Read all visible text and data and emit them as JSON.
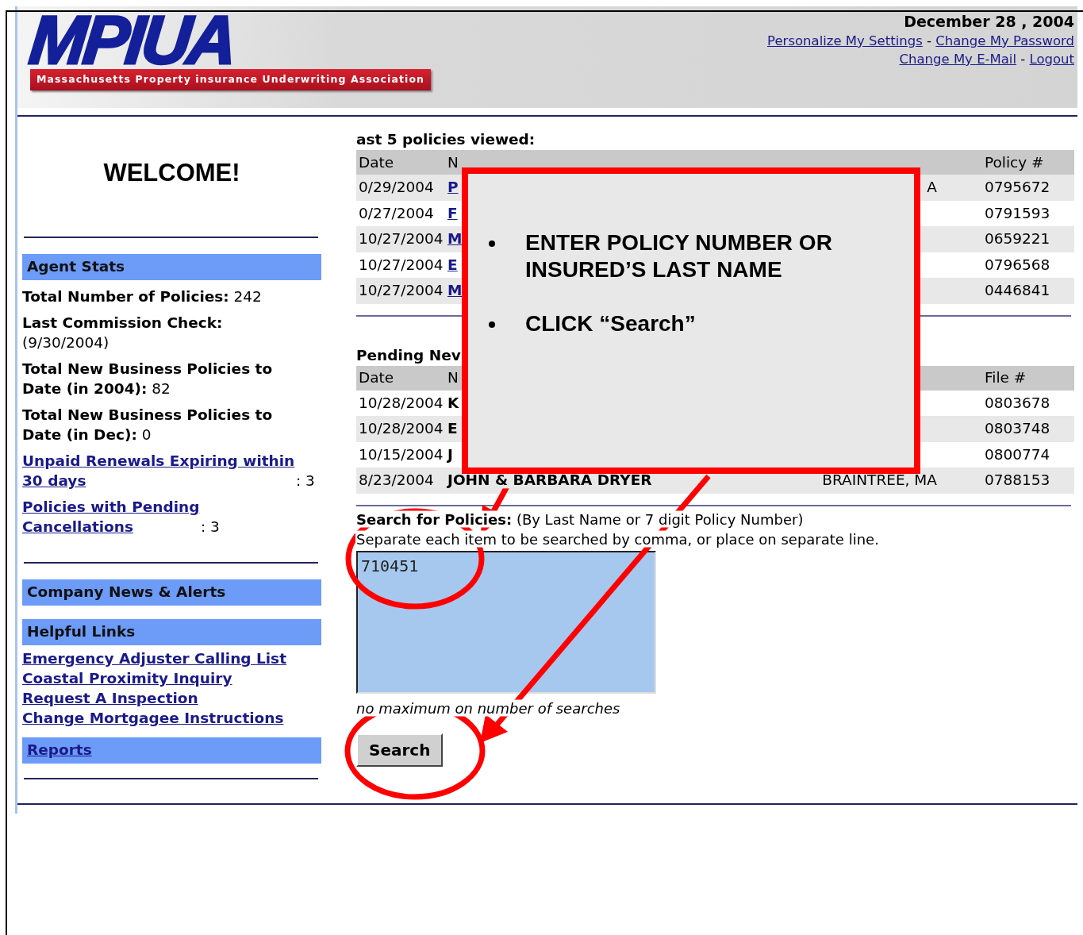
{
  "header": {
    "logo": "MPIUA",
    "logo_subtitle": "Massachusetts Property insurance Underwriting Association",
    "date": "December 28 , 2004",
    "link_rows": [
      [
        "Personalize My Settings",
        "Change My Password"
      ],
      [
        "Change My E-Mail",
        "Logout"
      ]
    ],
    "link_separator": "-"
  },
  "welcome": "WELCOME!",
  "agent_stats": {
    "title": "Agent Stats",
    "items": [
      {
        "kind": "text",
        "text": "**Total Number of Policies:** 242"
      },
      {
        "kind": "stacked",
        "label": "Last Commission Check:",
        "value": "(9/30/2004)"
      },
      {
        "kind": "text",
        "text": "**Total New Business Policies to Date (in 2004):** 82"
      },
      {
        "kind": "text",
        "text": "**Total New Business Policies to Date (in Dec):** 0"
      },
      {
        "kind": "link",
        "label": "Unpaid Renewals Expiring within 30 days",
        "value": ": 3"
      },
      {
        "kind": "link",
        "label": "Policies with Pending Cancellations",
        "value": ": 3"
      }
    ]
  },
  "company_news": {
    "title": "Company News & Alerts"
  },
  "helpful_links": {
    "title": "Helpful Links",
    "links": [
      "Emergency Adjuster Calling List",
      "Coastal Proximity Inquiry",
      "Request A Inspection",
      "Change Mortgagee Instructions"
    ]
  },
  "reports": {
    "title": "Reports"
  },
  "recent_policies": {
    "title": "ast 5 policies viewed:",
    "columns": [
      "Date",
      "N",
      "",
      "Policy #"
    ],
    "rows": [
      {
        "date": "0/29/2004",
        "name": "P",
        "city": "A",
        "number": "0795672"
      },
      {
        "date": "0/27/2004",
        "name": "F",
        "city": "",
        "number": "0791593"
      },
      {
        "date": "10/27/2004",
        "name": "M",
        "city": "",
        "number": "0659221"
      },
      {
        "date": "10/27/2004",
        "name": "E",
        "city": "",
        "number": "0796568"
      },
      {
        "date": "10/27/2004",
        "name": "M",
        "city": "",
        "number": "0446841"
      }
    ]
  },
  "pending_business": {
    "title": "Pending Nev",
    "columns": [
      "Date",
      "N",
      "",
      "File #"
    ],
    "rows": [
      {
        "date": "10/28/2004",
        "name": "K",
        "city": "",
        "number": "0803678"
      },
      {
        "date": "10/28/2004",
        "name": "E",
        "city": "",
        "number": "0803748"
      },
      {
        "date": "10/15/2004",
        "name": "J",
        "city": "",
        "number": "0800774"
      },
      {
        "date": "8/23/2004",
        "name": "JOHN & BARBARA DRYER",
        "city": "BRAINTREE, MA",
        "number": "0788153"
      }
    ]
  },
  "search": {
    "label": "**Search for Policies:** (By Last Name or 7 digit Policy Number)",
    "instructions": "Separate each item to be searched by comma, or place on separate line.",
    "value": "710451",
    "note": "no maximum on number of searches",
    "button": "Search"
  },
  "callout": {
    "bullets": [
      "ENTER POLICY NUMBER OR INSURED’S LAST NAME",
      "CLICK “Search”"
    ]
  }
}
